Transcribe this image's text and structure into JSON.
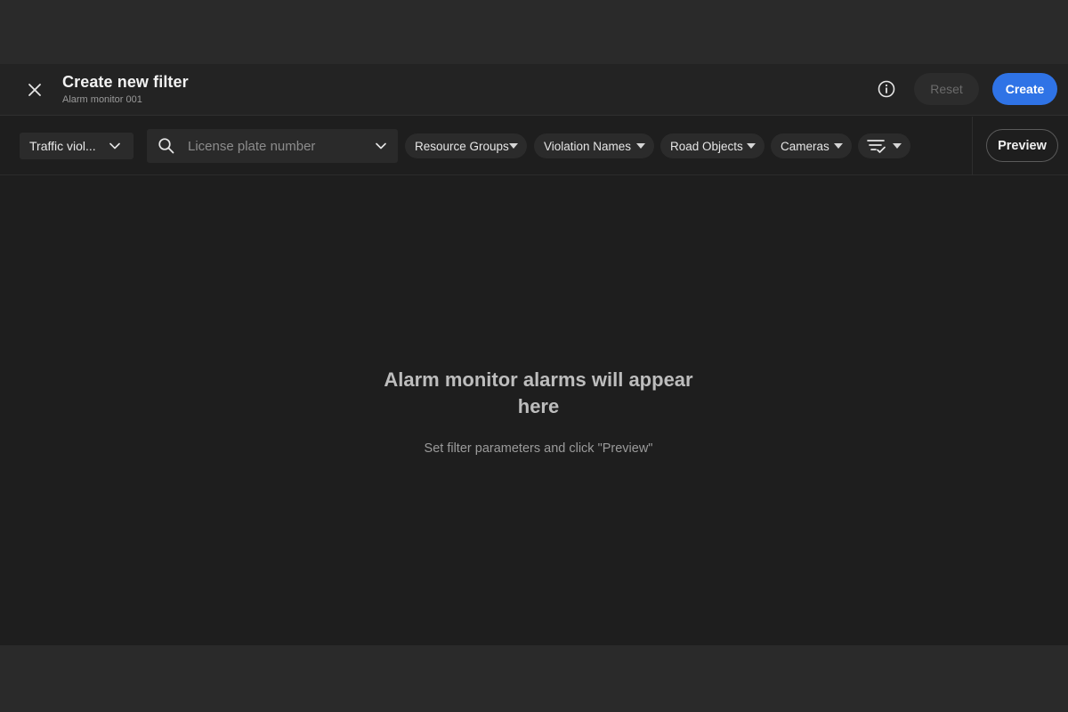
{
  "header": {
    "title": "Create new filter",
    "subtitle": "Alarm monitor 001",
    "reset_label": "Reset",
    "create_label": "Create",
    "close_icon": "close-icon",
    "info_icon": "info-icon"
  },
  "filterbar": {
    "type_select": {
      "value": "Traffic viol..."
    },
    "plate_input": {
      "placeholder": "License plate number",
      "value": ""
    },
    "chips": [
      {
        "label": "Resource Groups"
      },
      {
        "label": "Violation Names"
      },
      {
        "label": "Road Objects"
      },
      {
        "label": "Cameras"
      }
    ],
    "more_filters_icon": "filter-list-icon",
    "preview_label": "Preview"
  },
  "empty_state": {
    "title": "Alarm monitor alarms will appear here",
    "hint": "Set filter parameters and click \"Preview\""
  },
  "colors": {
    "accent": "#2f73e6",
    "background": "#1e1e1e"
  }
}
